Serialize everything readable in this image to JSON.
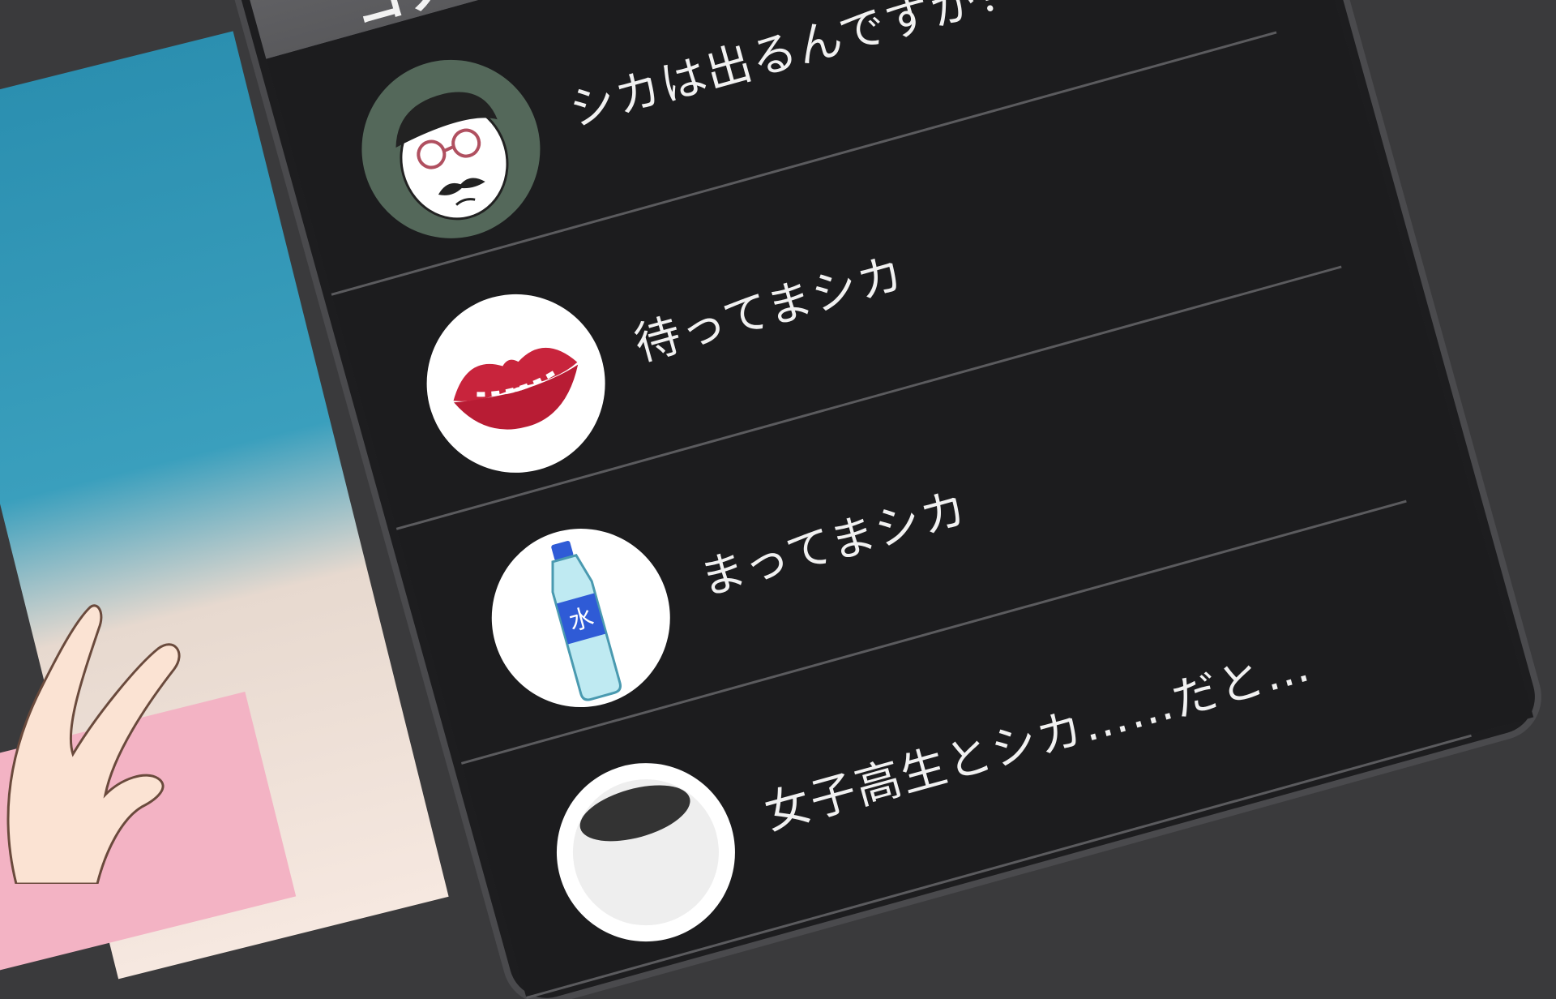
{
  "header": {
    "title": "コメ"
  },
  "comments": [
    {
      "text": "シカは出るんですか？",
      "avatar_icon": "glasses-mustache-man-icon"
    },
    {
      "text": "待ってまシカ",
      "avatar_icon": "red-lips-icon"
    },
    {
      "text": "まってまシカ",
      "avatar_icon": "water-bottle-icon",
      "bottle_label": "水"
    },
    {
      "text": "女子高生とシカ……だと…",
      "avatar_icon": "partial-avatar-icon"
    }
  ],
  "colors": {
    "list_bg": "#1c1c1e",
    "header_bg": "#6b6b6e",
    "text": "#f1f1f1",
    "divider": "#5b5b5e"
  }
}
